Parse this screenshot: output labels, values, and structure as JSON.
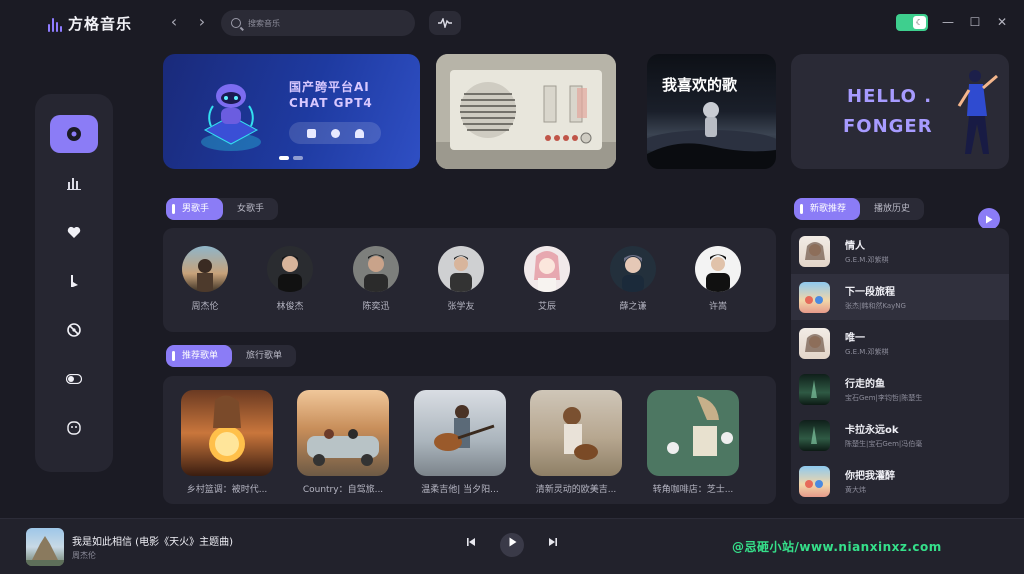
{
  "app": {
    "name": "方格音乐"
  },
  "search": {
    "placeholder": "搜索音乐"
  },
  "banners": {
    "ai_line1": "国产跨平台AI",
    "ai_line2": "CHAT GPT4",
    "favorite_songs": "我喜欢的歌",
    "hello_line1": "HELLO .",
    "hello_line2": "FONGER"
  },
  "sidebar": {
    "items": [
      {
        "icon": "disc-icon",
        "active": true
      },
      {
        "icon": "chart-bars-icon",
        "active": false
      },
      {
        "icon": "heart-icon",
        "active": false
      },
      {
        "icon": "music-note-icon",
        "active": false
      },
      {
        "icon": "no-disc-icon",
        "active": false
      },
      {
        "icon": "toggle-icon",
        "active": false
      },
      {
        "icon": "face-icon",
        "active": false
      }
    ]
  },
  "singer_tabs": [
    "男歌手",
    "女歌手"
  ],
  "artists": [
    "周杰伦",
    "林俊杰",
    "陈奕迅",
    "张学友",
    "艾辰",
    "薛之谦",
    "许嵩"
  ],
  "playlist_tabs": [
    "推荐歌单",
    "旅行歌单"
  ],
  "playlists": [
    "乡村篮调：被时代...",
    "Country：自驾旅...",
    "温柔吉他| 当夕阳...",
    "清新灵动的欧美吉...",
    "转角咖啡店：芝士..."
  ],
  "song_tabs": [
    "新歌推荐",
    "播放历史"
  ],
  "songs": [
    {
      "title": "情人",
      "artist": "G.E.M.邓紫棋"
    },
    {
      "title": "下一段旅程",
      "artist": "张杰|韩和然KayNG"
    },
    {
      "title": "唯一",
      "artist": "G.E.M.邓紫棋"
    },
    {
      "title": "行走的鱼",
      "artist": "宝石Gem|李钧哲|陈楚生"
    },
    {
      "title": "卡拉永远ok",
      "artist": "陈楚生|宝石Gem|冯伯毫"
    },
    {
      "title": "你把我灌醉",
      "artist": "黄大炜"
    }
  ],
  "player": {
    "title": "我是如此相信 (电影《天火》主题曲)",
    "artist": "周杰伦"
  },
  "watermark": "@忌砸小站/www.nianxinxz.com",
  "colors": {
    "accent": "#8b7cf6",
    "toggle": "#3ecf8e",
    "background": "#1b1b24",
    "panel": "#262631"
  }
}
